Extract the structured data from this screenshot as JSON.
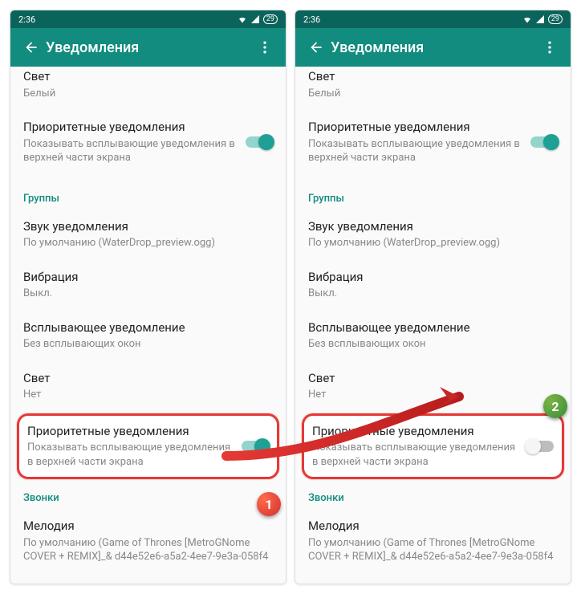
{
  "status": {
    "time": "2:36",
    "battery": "29"
  },
  "header": {
    "title": "Уведомления"
  },
  "badges": {
    "one": "1",
    "two": "2"
  },
  "screens": [
    {
      "light": {
        "title": "Свет",
        "sub": "Белый"
      },
      "priority_top": {
        "title": "Приоритетные уведомления",
        "sub": "Показывать всплывающие уведомления в верхней части экрана"
      },
      "groups_header": "Группы",
      "sound": {
        "title": "Звук уведомления",
        "sub": "По умолчанию (WaterDrop_preview.ogg)"
      },
      "vibration": {
        "title": "Вибрация",
        "sub": "Выкл."
      },
      "popup": {
        "title": "Всплывающее уведомление",
        "sub": "Без всплывающих окон"
      },
      "light2": {
        "title": "Свет",
        "sub": "Нет"
      },
      "priority_hl": {
        "title": "Приоритетные уведомления",
        "sub": "Показывать всплывающие уведомления в верхней части экрана",
        "toggle": "on"
      },
      "calls_header": "Звонки",
      "ringtone": {
        "title": "Мелодия",
        "sub": "По умолчанию (Game of Thrones [MetroGNome COVER + REMIX]_& d44e52e6-a5a2-4ee7-9e3a-058f4"
      }
    },
    {
      "light": {
        "title": "Свет",
        "sub": "Белый"
      },
      "priority_top": {
        "title": "Приоритетные уведомления",
        "sub": "Показывать всплывающие уведомления в верхней части экрана"
      },
      "groups_header": "Группы",
      "sound": {
        "title": "Звук уведомления",
        "sub": "По умолчанию (WaterDrop_preview.ogg)"
      },
      "vibration": {
        "title": "Вибрация",
        "sub": "Выкл."
      },
      "popup": {
        "title": "Всплывающее уведомление",
        "sub": "Без всплывающих окон"
      },
      "light2": {
        "title": "Свет",
        "sub": "Нет"
      },
      "priority_hl": {
        "title": "Приоритетные уведомления",
        "sub": "Показывать всплывающие уведомления в верхней части экрана",
        "toggle": "off"
      },
      "calls_header": "Звонки",
      "ringtone": {
        "title": "Мелодия",
        "sub": "По умолчанию (Game of Thrones [MetroGNome COVER + REMIX]_& d44e52e6-a5a2-4ee7-9e3a-058f4"
      }
    }
  ]
}
